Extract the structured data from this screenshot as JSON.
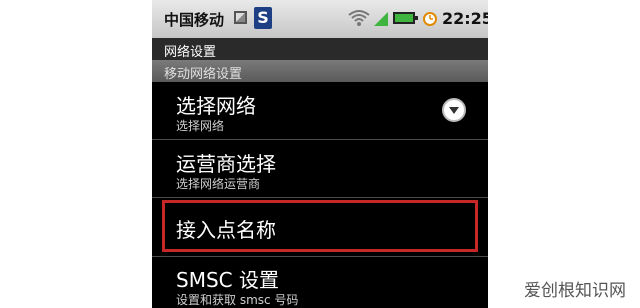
{
  "status_bar": {
    "carrier": "中国移动",
    "clock": "22:25",
    "icons": [
      "image-notification-icon",
      "s-app-icon",
      "wifi-icon",
      "signal-icon",
      "battery-icon",
      "alarm-clock-icon"
    ],
    "s_app_letter": "S"
  },
  "title_bar": {
    "title": "网络设置"
  },
  "section": {
    "header": "移动网络设置"
  },
  "items": [
    {
      "label": "选择网络",
      "summary": "选择网络"
    },
    {
      "label": "运营商选择",
      "summary": "选择网络运营商"
    },
    {
      "label": "接入点名称",
      "summary": ""
    },
    {
      "label": "SMSC 设置",
      "summary": "设置和获取 smsc 号码"
    }
  ],
  "highlight_color": "#c62828",
  "watermark": "爱创根知识网"
}
